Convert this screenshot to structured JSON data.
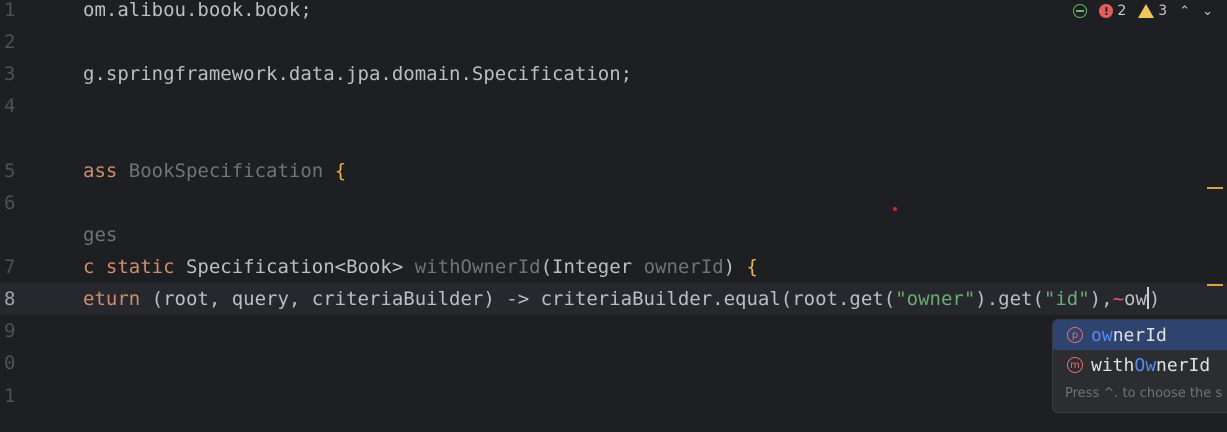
{
  "inspections": {
    "errors": "2",
    "warnings": "3"
  },
  "gutter": [
    "1",
    "2",
    "3",
    "4",
    "5",
    "6",
    "7",
    "8",
    "9",
    "0",
    "1"
  ],
  "code": {
    "line1": "om.alibou.book.book;",
    "line3": "g.springframework.data.jpa.domain.Specification;",
    "line5_kw": "ass",
    "line5_name": "BookSpecification",
    "line5_brace": "{",
    "usages_hint": "ges",
    "line7_kw": "c static",
    "line7_type": "Specification<Book>",
    "line7_fn": "withOwnerId",
    "line7_paren_open": "(Integer ",
    "line7_param": "ownerId",
    "line7_paren_close": ")",
    "line7_brace": "{",
    "line8_kw": "eturn",
    "line8_a": " (root, query, criteriaBuilder) -> criteriaBuilder.equal(root.get(",
    "line8_str1": "\"owner\"",
    "line8_b": ").get(",
    "line8_str2": "\"id\"",
    "line8_c": "),",
    "line8_typed": "ow",
    "line8_close": ")"
  },
  "completion": {
    "items": [
      {
        "badge": "p",
        "match": "ow",
        "rest": "nerId",
        "prefix": ""
      },
      {
        "badge": "m",
        "prefix": "with",
        "match": "Ow",
        "rest": "nerId"
      }
    ],
    "footer": "Press ^. to choose the s"
  }
}
